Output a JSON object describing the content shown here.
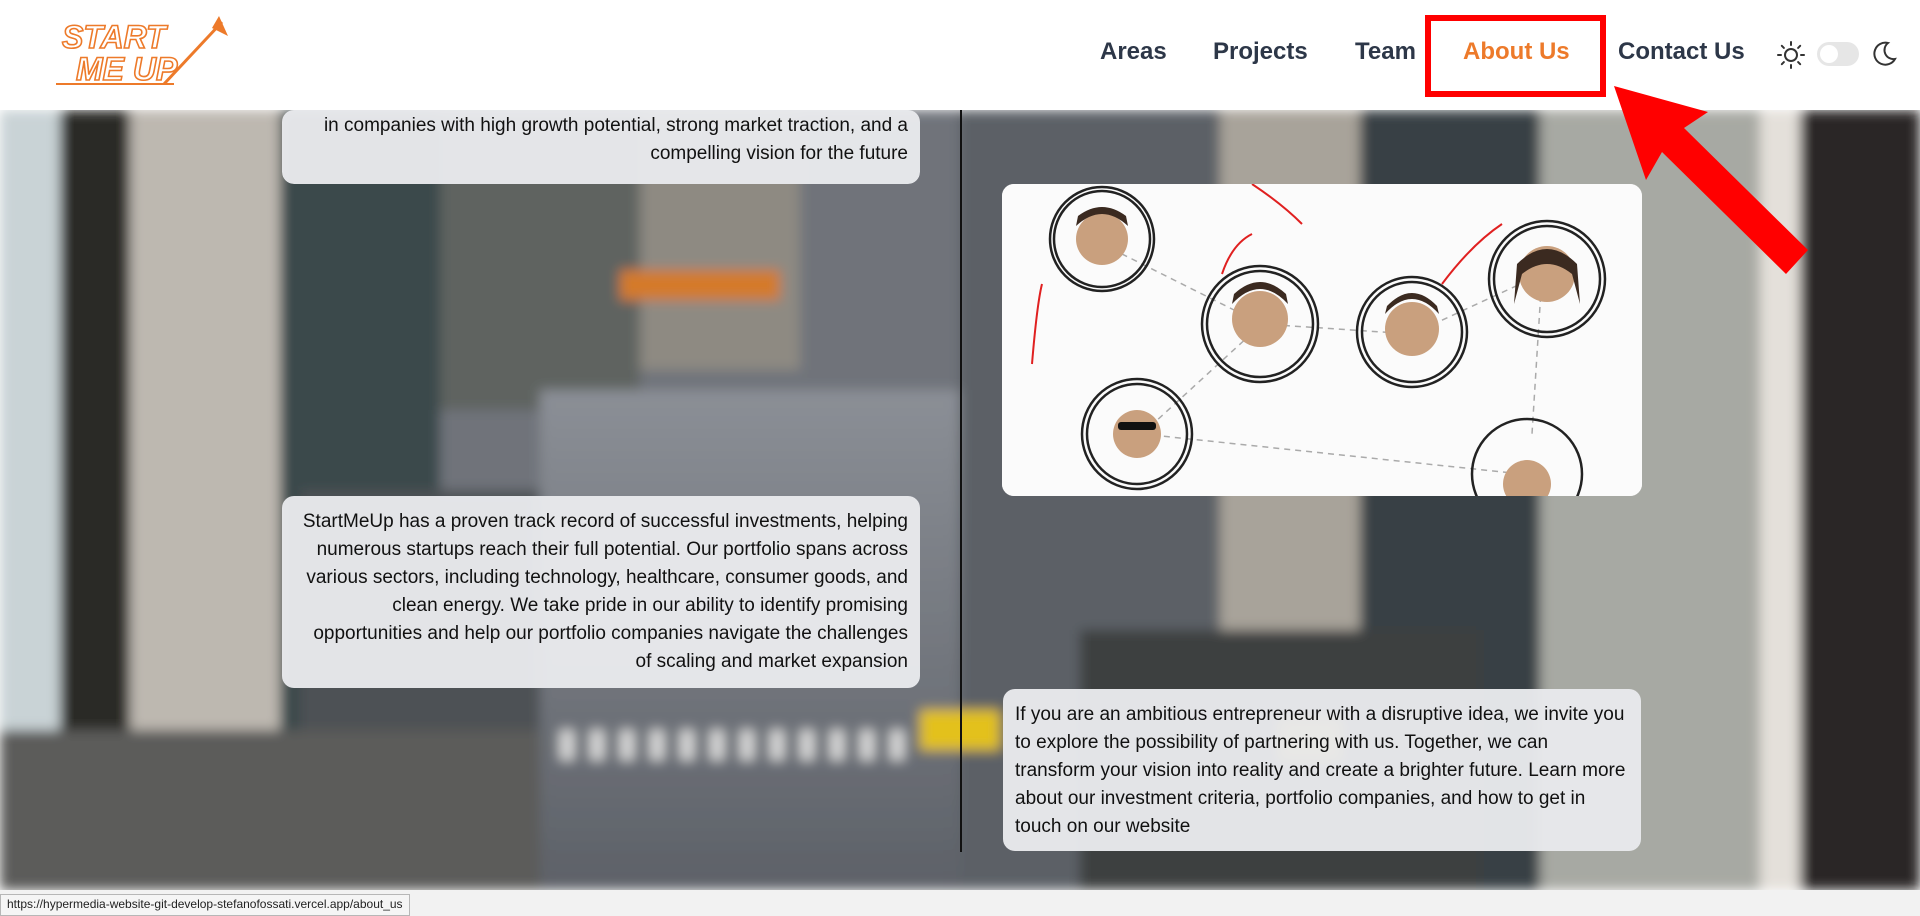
{
  "logo": {
    "line1": "START",
    "line2": "ME UP",
    "icon": "rocket-arrow-icon"
  },
  "nav": {
    "items": [
      {
        "label": "Areas"
      },
      {
        "label": "Projects"
      },
      {
        "label": "Team"
      },
      {
        "label": "About Us",
        "active": true
      },
      {
        "label": "Contact Us"
      }
    ],
    "theme_toggle": {
      "light_icon": "sun-icon",
      "dark_icon": "moon-icon",
      "state": "light"
    }
  },
  "content": {
    "card1_text": "in companies with high growth potential, strong market traction, and a compelling vision for the future",
    "card2_text": "StartMeUp has a proven track record of successful investments, helping numerous startups reach their full potential. Our portfolio spans across various sectors, including technology, healthcare, consumer goods, and clean energy. We take pride in our ability to identify promising opportunities and help our portfolio companies navigate the challenges of scaling and market expansion",
    "card3_text": "If you are an ambitious entrepreneur with a disruptive idea, we invite you to explore the possibility of partnering with us. Together, we can transform your vision into reality and create a brighter future. Learn more about our investment criteria, portfolio companies, and how to get in touch on our website"
  },
  "status_bar": {
    "url": "https://hypermedia-website-git-develop-stefanofossati.vercel.app/about_us"
  },
  "colors": {
    "accent": "#ed7a2a",
    "highlight": "#ff0000",
    "nav_text": "#2d3748"
  }
}
